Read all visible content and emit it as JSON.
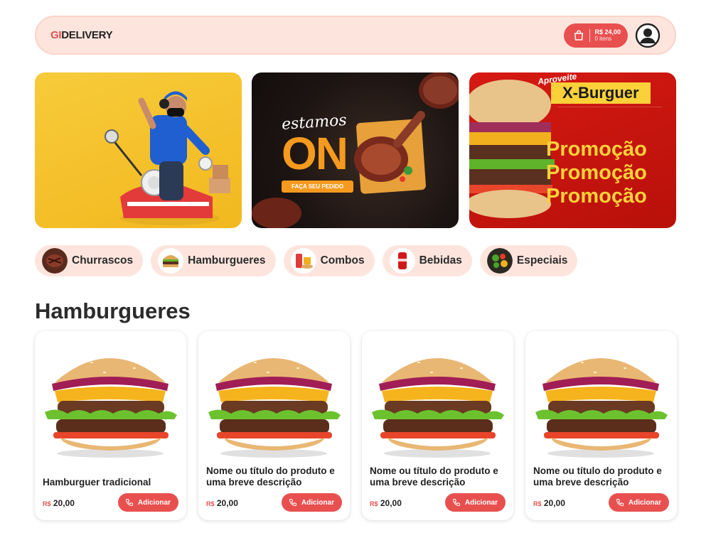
{
  "header": {
    "logo_prefix": "GI",
    "logo_suffix": "DELIVERY",
    "cart_total": "R$ 24,00",
    "cart_items": "0 itens",
    "cart_icon": "shopping-bag-icon",
    "avatar_icon": "user-circle-icon"
  },
  "banners": {
    "b2_line1": "estamos",
    "b2_line2": "ON",
    "b2_cta": "FAÇA SEU PEDIDO",
    "b3_kicker": "Aproveite",
    "b3_title": "X-Burguer",
    "b3_promo": [
      "Promoção",
      "Promoção",
      "Promoção"
    ]
  },
  "categories": [
    {
      "label": "Churrascos"
    },
    {
      "label": "Hamburgueres"
    },
    {
      "label": "Combos"
    },
    {
      "label": "Bebidas"
    },
    {
      "label": "Especiais"
    }
  ],
  "section": {
    "title": "Hamburgueres"
  },
  "products": [
    {
      "title": "Hamburguer tradicional",
      "currency": "R$",
      "price": "20,00",
      "button": "Adicionar"
    },
    {
      "title": "Nome ou título do produto e uma breve descrição",
      "currency": "R$",
      "price": "20,00",
      "button": "Adicionar"
    },
    {
      "title": "Nome ou título do produto e uma breve descrição",
      "currency": "R$",
      "price": "20,00",
      "button": "Adicionar"
    },
    {
      "title": "Nome ou título do produto e uma breve descrição",
      "currency": "R$",
      "price": "20,00",
      "button": "Adicionar"
    }
  ],
  "colors": {
    "accent": "#e8504f",
    "soft": "#fde5de",
    "promo_yellow": "#fbd13a"
  }
}
